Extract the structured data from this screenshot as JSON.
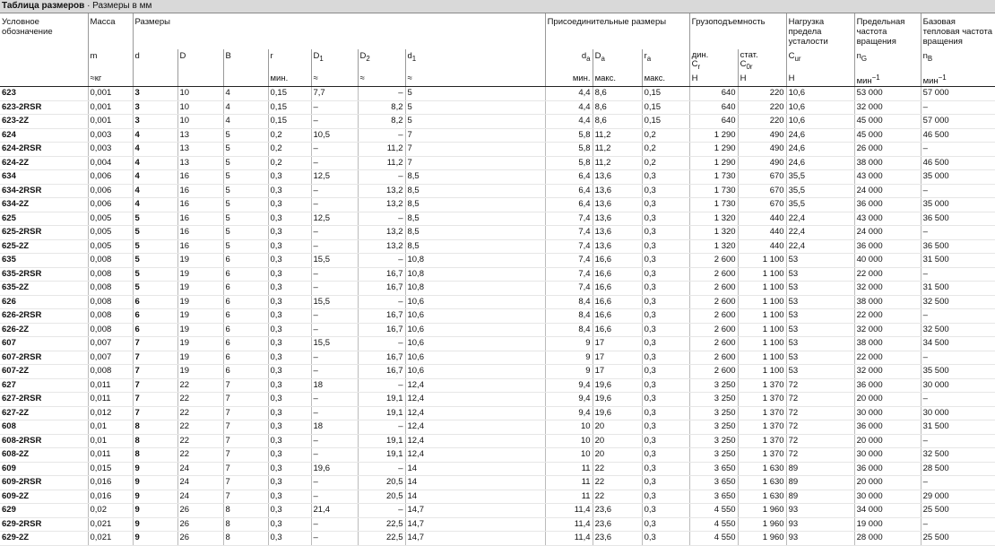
{
  "header": {
    "title_bold": "Таблица размеров",
    "title_rest": " · Размеры в мм",
    "groups": {
      "designation": "Условное обозначение",
      "mass": "Масса",
      "dimensions": "Размеры",
      "mounting": "Присоединительные размеры",
      "load": "Грузоподъемность",
      "fatigue": "Нагрузка предела усталости",
      "limit_speed": "Предельная частота вращения",
      "ref_speed": "Базовая тепловая частота вращения"
    },
    "symbols": {
      "m": "m",
      "d": "d",
      "D": "D",
      "B": "B",
      "r": "r",
      "D1": "D",
      "D1_sub": "1",
      "D2": "D",
      "D2_sub": "2",
      "d1": "d",
      "d1_sub": "1",
      "da": "d",
      "da_sub": "a",
      "Da": "D",
      "Da_sub": "a",
      "ra": "r",
      "ra_sub": "a",
      "dyn": "дин.",
      "Cr": "C",
      "Cr_sub": "r",
      "stat": "стат.",
      "C0r": "C",
      "C0r_sub": "0r",
      "Cur": "C",
      "Cur_sub": "ur",
      "nG": "n",
      "nG_sub": "G",
      "nB": "n",
      "nB_sub": "B"
    },
    "units": {
      "m": "≈кг",
      "r": "мин.",
      "D1": "≈",
      "D2": "≈",
      "d1": "≈",
      "da": "мин.",
      "Da": "макс.",
      "ra": "макс.",
      "Cr": "Н",
      "C0r": "Н",
      "Cur": "Н",
      "nG": "мин",
      "nG_sup": "−1",
      "nB": "мин",
      "nB_sup": "−1"
    }
  },
  "rows": [
    {
      "des": "623",
      "m": "0,001",
      "d": "3",
      "D": "10",
      "B": "4",
      "r": "0,15",
      "D1": "7,7",
      "D2": "–",
      "d1": "5",
      "da": "4,4",
      "Da": "8,6",
      "ra": "0,15",
      "Cr": "640",
      "C0r": "220",
      "Cur": "10,6",
      "nG": "53 000",
      "nB": "57 000",
      "gs": true
    },
    {
      "des": "623-2RSR",
      "m": "0,001",
      "d": "3",
      "D": "10",
      "B": "4",
      "r": "0,15",
      "D1": "–",
      "D2": "8,2",
      "d1": "5",
      "da": "4,4",
      "Da": "8,6",
      "ra": "0,15",
      "Cr": "640",
      "C0r": "220",
      "Cur": "10,6",
      "nG": "32 000",
      "nB": "–"
    },
    {
      "des": "623-2Z",
      "m": "0,001",
      "d": "3",
      "D": "10",
      "B": "4",
      "r": "0,15",
      "D1": "–",
      "D2": "8,2",
      "d1": "5",
      "da": "4,4",
      "Da": "8,6",
      "ra": "0,15",
      "Cr": "640",
      "C0r": "220",
      "Cur": "10,6",
      "nG": "45 000",
      "nB": "57 000"
    },
    {
      "des": "624",
      "m": "0,003",
      "d": "4",
      "D": "13",
      "B": "5",
      "r": "0,2",
      "D1": "10,5",
      "D2": "–",
      "d1": "7",
      "da": "5,8",
      "Da": "11,2",
      "ra": "0,2",
      "Cr": "1 290",
      "C0r": "490",
      "Cur": "24,6",
      "nG": "45 000",
      "nB": "46 500",
      "gs": true
    },
    {
      "des": "624-2RSR",
      "m": "0,003",
      "d": "4",
      "D": "13",
      "B": "5",
      "r": "0,2",
      "D1": "–",
      "D2": "11,2",
      "d1": "7",
      "da": "5,8",
      "Da": "11,2",
      "ra": "0,2",
      "Cr": "1 290",
      "C0r": "490",
      "Cur": "24,6",
      "nG": "26 000",
      "nB": "–"
    },
    {
      "des": "624-2Z",
      "m": "0,004",
      "d": "4",
      "D": "13",
      "B": "5",
      "r": "0,2",
      "D1": "–",
      "D2": "11,2",
      "d1": "7",
      "da": "5,8",
      "Da": "11,2",
      "ra": "0,2",
      "Cr": "1 290",
      "C0r": "490",
      "Cur": "24,6",
      "nG": "38 000",
      "nB": "46 500"
    },
    {
      "des": "634",
      "m": "0,006",
      "d": "4",
      "D": "16",
      "B": "5",
      "r": "0,3",
      "D1": "12,5",
      "D2": "–",
      "d1": "8,5",
      "da": "6,4",
      "Da": "13,6",
      "ra": "0,3",
      "Cr": "1 730",
      "C0r": "670",
      "Cur": "35,5",
      "nG": "43 000",
      "nB": "35 000"
    },
    {
      "des": "634-2RSR",
      "m": "0,006",
      "d": "4",
      "D": "16",
      "B": "5",
      "r": "0,3",
      "D1": "–",
      "D2": "13,2",
      "d1": "8,5",
      "da": "6,4",
      "Da": "13,6",
      "ra": "0,3",
      "Cr": "1 730",
      "C0r": "670",
      "Cur": "35,5",
      "nG": "24 000",
      "nB": "–"
    },
    {
      "des": "634-2Z",
      "m": "0,006",
      "d": "4",
      "D": "16",
      "B": "5",
      "r": "0,3",
      "D1": "–",
      "D2": "13,2",
      "d1": "8,5",
      "da": "6,4",
      "Da": "13,6",
      "ra": "0,3",
      "Cr": "1 730",
      "C0r": "670",
      "Cur": "35,5",
      "nG": "36 000",
      "nB": "35 000"
    },
    {
      "des": "625",
      "m": "0,005",
      "d": "5",
      "D": "16",
      "B": "5",
      "r": "0,3",
      "D1": "12,5",
      "D2": "–",
      "d1": "8,5",
      "da": "7,4",
      "Da": "13,6",
      "ra": "0,3",
      "Cr": "1 320",
      "C0r": "440",
      "Cur": "22,4",
      "nG": "43 000",
      "nB": "36 500",
      "gs": true
    },
    {
      "des": "625-2RSR",
      "m": "0,005",
      "d": "5",
      "D": "16",
      "B": "5",
      "r": "0,3",
      "D1": "–",
      "D2": "13,2",
      "d1": "8,5",
      "da": "7,4",
      "Da": "13,6",
      "ra": "0,3",
      "Cr": "1 320",
      "C0r": "440",
      "Cur": "22,4",
      "nG": "24 000",
      "nB": "–"
    },
    {
      "des": "625-2Z",
      "m": "0,005",
      "d": "5",
      "D": "16",
      "B": "5",
      "r": "0,3",
      "D1": "–",
      "D2": "13,2",
      "d1": "8,5",
      "da": "7,4",
      "Da": "13,6",
      "ra": "0,3",
      "Cr": "1 320",
      "C0r": "440",
      "Cur": "22,4",
      "nG": "36 000",
      "nB": "36 500"
    },
    {
      "des": "635",
      "m": "0,008",
      "d": "5",
      "D": "19",
      "B": "6",
      "r": "0,3",
      "D1": "15,5",
      "D2": "–",
      "d1": "10,8",
      "da": "7,4",
      "Da": "16,6",
      "ra": "0,3",
      "Cr": "2 600",
      "C0r": "1 100",
      "Cur": "53",
      "nG": "40 000",
      "nB": "31 500"
    },
    {
      "des": "635-2RSR",
      "m": "0,008",
      "d": "5",
      "D": "19",
      "B": "6",
      "r": "0,3",
      "D1": "–",
      "D2": "16,7",
      "d1": "10,8",
      "da": "7,4",
      "Da": "16,6",
      "ra": "0,3",
      "Cr": "2 600",
      "C0r": "1 100",
      "Cur": "53",
      "nG": "22 000",
      "nB": "–"
    },
    {
      "des": "635-2Z",
      "m": "0,008",
      "d": "5",
      "D": "19",
      "B": "6",
      "r": "0,3",
      "D1": "–",
      "D2": "16,7",
      "d1": "10,8",
      "da": "7,4",
      "Da": "16,6",
      "ra": "0,3",
      "Cr": "2 600",
      "C0r": "1 100",
      "Cur": "53",
      "nG": "32 000",
      "nB": "31 500"
    },
    {
      "des": "626",
      "m": "0,008",
      "d": "6",
      "D": "19",
      "B": "6",
      "r": "0,3",
      "D1": "15,5",
      "D2": "–",
      "d1": "10,6",
      "da": "8,4",
      "Da": "16,6",
      "ra": "0,3",
      "Cr": "2 600",
      "C0r": "1 100",
      "Cur": "53",
      "nG": "38 000",
      "nB": "32 500",
      "gs": true
    },
    {
      "des": "626-2RSR",
      "m": "0,008",
      "d": "6",
      "D": "19",
      "B": "6",
      "r": "0,3",
      "D1": "–",
      "D2": "16,7",
      "d1": "10,6",
      "da": "8,4",
      "Da": "16,6",
      "ra": "0,3",
      "Cr": "2 600",
      "C0r": "1 100",
      "Cur": "53",
      "nG": "22 000",
      "nB": "–"
    },
    {
      "des": "626-2Z",
      "m": "0,008",
      "d": "6",
      "D": "19",
      "B": "6",
      "r": "0,3",
      "D1": "–",
      "D2": "16,7",
      "d1": "10,6",
      "da": "8,4",
      "Da": "16,6",
      "ra": "0,3",
      "Cr": "2 600",
      "C0r": "1 100",
      "Cur": "53",
      "nG": "32 000",
      "nB": "32 500"
    },
    {
      "des": "607",
      "m": "0,007",
      "d": "7",
      "D": "19",
      "B": "6",
      "r": "0,3",
      "D1": "15,5",
      "D2": "–",
      "d1": "10,6",
      "da": "9",
      "Da": "17",
      "ra": "0,3",
      "Cr": "2 600",
      "C0r": "1 100",
      "Cur": "53",
      "nG": "38 000",
      "nB": "34 500",
      "gs": true
    },
    {
      "des": "607-2RSR",
      "m": "0,007",
      "d": "7",
      "D": "19",
      "B": "6",
      "r": "0,3",
      "D1": "–",
      "D2": "16,7",
      "d1": "10,6",
      "da": "9",
      "Da": "17",
      "ra": "0,3",
      "Cr": "2 600",
      "C0r": "1 100",
      "Cur": "53",
      "nG": "22 000",
      "nB": "–"
    },
    {
      "des": "607-2Z",
      "m": "0,008",
      "d": "7",
      "D": "19",
      "B": "6",
      "r": "0,3",
      "D1": "–",
      "D2": "16,7",
      "d1": "10,6",
      "da": "9",
      "Da": "17",
      "ra": "0,3",
      "Cr": "2 600",
      "C0r": "1 100",
      "Cur": "53",
      "nG": "32 000",
      "nB": "35 500"
    },
    {
      "des": "627",
      "m": "0,011",
      "d": "7",
      "D": "22",
      "B": "7",
      "r": "0,3",
      "D1": "18",
      "D2": "–",
      "d1": "12,4",
      "da": "9,4",
      "Da": "19,6",
      "ra": "0,3",
      "Cr": "3 250",
      "C0r": "1 370",
      "Cur": "72",
      "nG": "36 000",
      "nB": "30 000"
    },
    {
      "des": "627-2RSR",
      "m": "0,011",
      "d": "7",
      "D": "22",
      "B": "7",
      "r": "0,3",
      "D1": "–",
      "D2": "19,1",
      "d1": "12,4",
      "da": "9,4",
      "Da": "19,6",
      "ra": "0,3",
      "Cr": "3 250",
      "C0r": "1 370",
      "Cur": "72",
      "nG": "20 000",
      "nB": "–"
    },
    {
      "des": "627-2Z",
      "m": "0,012",
      "d": "7",
      "D": "22",
      "B": "7",
      "r": "0,3",
      "D1": "–",
      "D2": "19,1",
      "d1": "12,4",
      "da": "9,4",
      "Da": "19,6",
      "ra": "0,3",
      "Cr": "3 250",
      "C0r": "1 370",
      "Cur": "72",
      "nG": "30 000",
      "nB": "30 000"
    },
    {
      "des": "608",
      "m": "0,01",
      "d": "8",
      "D": "22",
      "B": "7",
      "r": "0,3",
      "D1": "18",
      "D2": "–",
      "d1": "12,4",
      "da": "10",
      "Da": "20",
      "ra": "0,3",
      "Cr": "3 250",
      "C0r": "1 370",
      "Cur": "72",
      "nG": "36 000",
      "nB": "31 500",
      "gs": true
    },
    {
      "des": "608-2RSR",
      "m": "0,01",
      "d": "8",
      "D": "22",
      "B": "7",
      "r": "0,3",
      "D1": "–",
      "D2": "19,1",
      "d1": "12,4",
      "da": "10",
      "Da": "20",
      "ra": "0,3",
      "Cr": "3 250",
      "C0r": "1 370",
      "Cur": "72",
      "nG": "20 000",
      "nB": "–"
    },
    {
      "des": "608-2Z",
      "m": "0,011",
      "d": "8",
      "D": "22",
      "B": "7",
      "r": "0,3",
      "D1": "–",
      "D2": "19,1",
      "d1": "12,4",
      "da": "10",
      "Da": "20",
      "ra": "0,3",
      "Cr": "3 250",
      "C0r": "1 370",
      "Cur": "72",
      "nG": "30 000",
      "nB": "32 500"
    },
    {
      "des": "609",
      "m": "0,015",
      "d": "9",
      "D": "24",
      "B": "7",
      "r": "0,3",
      "D1": "19,6",
      "D2": "–",
      "d1": "14",
      "da": "11",
      "Da": "22",
      "ra": "0,3",
      "Cr": "3 650",
      "C0r": "1 630",
      "Cur": "89",
      "nG": "36 000",
      "nB": "28 500",
      "gs": true
    },
    {
      "des": "609-2RSR",
      "m": "0,016",
      "d": "9",
      "D": "24",
      "B": "7",
      "r": "0,3",
      "D1": "–",
      "D2": "20,5",
      "d1": "14",
      "da": "11",
      "Da": "22",
      "ra": "0,3",
      "Cr": "3 650",
      "C0r": "1 630",
      "Cur": "89",
      "nG": "20 000",
      "nB": "–"
    },
    {
      "des": "609-2Z",
      "m": "0,016",
      "d": "9",
      "D": "24",
      "B": "7",
      "r": "0,3",
      "D1": "–",
      "D2": "20,5",
      "d1": "14",
      "da": "11",
      "Da": "22",
      "ra": "0,3",
      "Cr": "3 650",
      "C0r": "1 630",
      "Cur": "89",
      "nG": "30 000",
      "nB": "29 000"
    },
    {
      "des": "629",
      "m": "0,02",
      "d": "9",
      "D": "26",
      "B": "8",
      "r": "0,3",
      "D1": "21,4",
      "D2": "–",
      "d1": "14,7",
      "da": "11,4",
      "Da": "23,6",
      "ra": "0,3",
      "Cr": "4 550",
      "C0r": "1 960",
      "Cur": "93",
      "nG": "34 000",
      "nB": "25 500"
    },
    {
      "des": "629-2RSR",
      "m": "0,021",
      "d": "9",
      "D": "26",
      "B": "8",
      "r": "0,3",
      "D1": "–",
      "D2": "22,5",
      "d1": "14,7",
      "da": "11,4",
      "Da": "23,6",
      "ra": "0,3",
      "Cr": "4 550",
      "C0r": "1 960",
      "Cur": "93",
      "nG": "19 000",
      "nB": "–"
    },
    {
      "des": "629-2Z",
      "m": "0,021",
      "d": "9",
      "D": "26",
      "B": "8",
      "r": "0,3",
      "D1": "–",
      "D2": "22,5",
      "d1": "14,7",
      "da": "11,4",
      "Da": "23,6",
      "ra": "0,3",
      "Cr": "4 550",
      "C0r": "1 960",
      "Cur": "93",
      "nG": "28 000",
      "nB": "25 500"
    }
  ]
}
